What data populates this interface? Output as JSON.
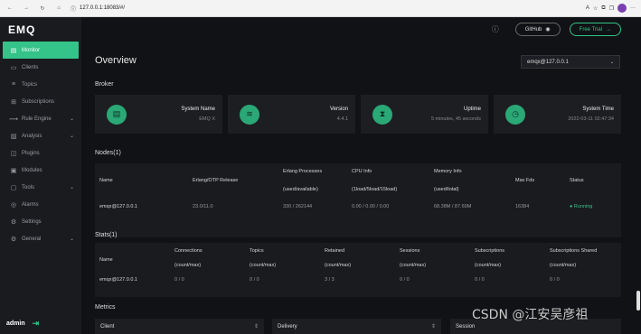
{
  "browser": {
    "url": "127.0.0.1:18083/#/"
  },
  "sidebar": {
    "logo": "EMQ",
    "items": [
      {
        "label": "Monitor",
        "icon": "▤",
        "active": true,
        "chev": ""
      },
      {
        "label": "Clients",
        "icon": "▭",
        "chev": ""
      },
      {
        "label": "Topics",
        "icon": "≡",
        "chev": ""
      },
      {
        "label": "Subscriptions",
        "icon": "⊞",
        "chev": ""
      },
      {
        "label": "Rule Engine",
        "icon": "⟿",
        "chev": "⌄"
      },
      {
        "label": "Analysis",
        "icon": "▨",
        "chev": "⌄"
      },
      {
        "label": "Plugins",
        "icon": "◫",
        "chev": ""
      },
      {
        "label": "Modules",
        "icon": "▣",
        "chev": ""
      },
      {
        "label": "Tools",
        "icon": "▢",
        "chev": "⌄"
      },
      {
        "label": "Alarms",
        "icon": "◎",
        "chev": ""
      },
      {
        "label": "Settings",
        "icon": "⚙",
        "chev": ""
      },
      {
        "label": "General",
        "icon": "⚙",
        "chev": "⌄"
      }
    ],
    "user": "admin"
  },
  "header": {
    "github": "GitHub",
    "free_trial": "Free Trial"
  },
  "overview": {
    "title": "Overview",
    "node_select": "emqx@127.0.0.1"
  },
  "broker": {
    "title": "Broker",
    "cards": [
      {
        "label": "System Name",
        "value": "EMQ X",
        "icon": "▤"
      },
      {
        "label": "Version",
        "value": "4.4.1",
        "icon": "≋"
      },
      {
        "label": "Uptime",
        "value": "5 minutes, 45 seconds",
        "icon": "⧗"
      },
      {
        "label": "System Time",
        "value": "2022-03-11 02:47:34",
        "icon": "◷"
      }
    ]
  },
  "nodes": {
    "title": "Nodes(1)",
    "headers": {
      "name": "Name",
      "otp": "Erlang/OTP Release",
      "proc": "Erlang Processes",
      "proc_sub": "(used/available)",
      "cpu": "CPU Info",
      "cpu_sub": "(1load/5load/15load)",
      "mem": "Memory Info",
      "mem_sub": "(used/total)",
      "maxfds": "Max Fds",
      "status": "Status"
    },
    "row": {
      "name": "emqx@127.0.0.1",
      "otp": "23.0/11.0",
      "proc": "330 / 262144",
      "cpu": "0.00 / 0.00 / 0.00",
      "mem": "68.38M / 87.69M",
      "maxfds": "16384",
      "status": "Running"
    }
  },
  "stats": {
    "title": "Stats(1)",
    "headers": {
      "name": "Name",
      "connections": "Connections",
      "topics": "Topics",
      "retained": "Retained",
      "sessions": "Sessions",
      "subscriptions": "Subscriptions",
      "subs_shared": "Subscriptions Shared",
      "sub": "(count/max)"
    },
    "row": {
      "name": "emqx@127.0.0.1",
      "connections": "0 / 0",
      "topics": "0 / 0",
      "retained": "3 / 3",
      "sessions": "0 / 0",
      "subscriptions": "0 / 0",
      "subs_shared": "0 / 0"
    }
  },
  "metrics": {
    "title": "Metrics",
    "cards": [
      "Client",
      "Delivery",
      "Session"
    ]
  },
  "watermark": "CSDN @江安吴彦祖"
}
